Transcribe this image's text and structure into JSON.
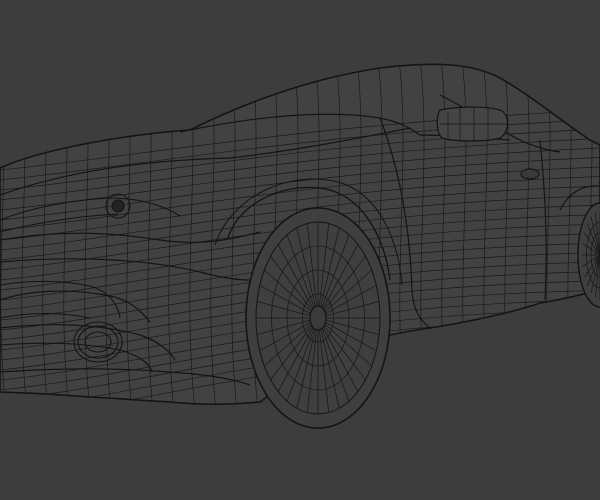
{
  "viewport": {
    "background": "#3d3d3d",
    "wire_color": "#141414",
    "shading": "wireframe",
    "subject": "car-mesh"
  }
}
